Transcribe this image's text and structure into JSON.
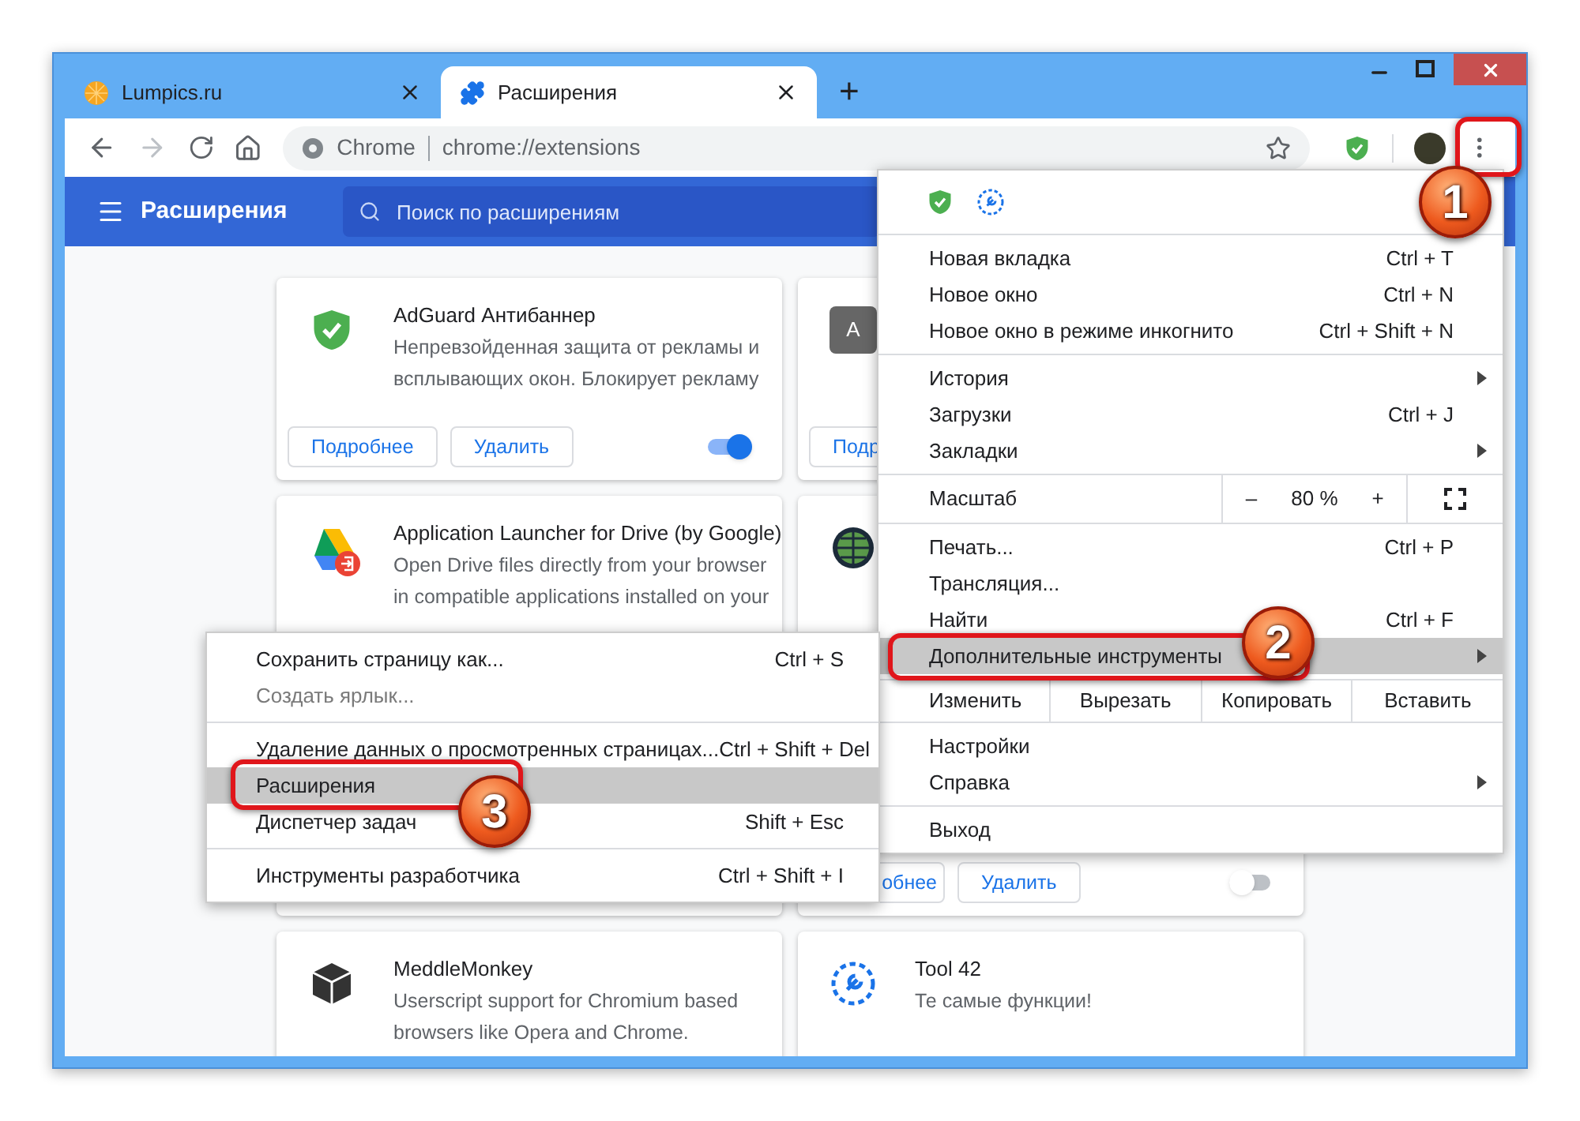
{
  "window": {
    "tabs": [
      {
        "title": "Lumpics.ru",
        "selected": false
      },
      {
        "title": "Расширения",
        "selected": true
      }
    ],
    "new_tab": "+"
  },
  "toolbar": {
    "site_label": "Chrome",
    "url": "chrome://extensions"
  },
  "header": {
    "title": "Расширения",
    "search_placeholder": "Поиск по расширениям"
  },
  "cards": [
    {
      "title": "AdGuard Антибаннер",
      "description": [
        "Непревзойденная защита от рекламы и",
        "всплывающих окон. Блокирует рекламу"
      ],
      "buttons": [
        "Подробнее",
        "Удалить"
      ],
      "toggle": {
        "on": true
      }
    },
    {
      "letter": "A",
      "buttons": [
        "Подр"
      ]
    },
    {
      "title": "Application Launcher for Drive (by Google)",
      "description": [
        "Open Drive files directly from your browser",
        "in compatible applications installed on your"
      ]
    },
    {
      "buttons": [
        "обнее",
        "Удалить"
      ],
      "toggle": {
        "on": false
      }
    },
    {
      "title": "MeddleMonkey",
      "description": [
        "Userscript support for Chromium based",
        "browsers like Opera and Chrome."
      ]
    },
    {
      "title": "Tool 42",
      "description": [
        "Те самые функции!"
      ]
    }
  ],
  "menu": {
    "sections": [
      [
        {
          "kind": "item",
          "label": "Новая вкладка",
          "shortcut": "Ctrl + T",
          "arrow": false,
          "selected": false
        },
        {
          "kind": "item",
          "label": "Новое окно",
          "shortcut": "Ctrl + N",
          "arrow": false,
          "selected": false
        },
        {
          "kind": "item",
          "label": "Новое окно в режиме инкогнито",
          "shortcut": "Ctrl + Shift + N",
          "arrow": false,
          "selected": false
        }
      ],
      [
        {
          "kind": "item",
          "label": "История",
          "arrow": true,
          "selected": false
        },
        {
          "kind": "item",
          "label": "Загрузки",
          "shortcut": "Ctrl + J",
          "arrow": false,
          "selected": false
        },
        {
          "kind": "item",
          "label": "Закладки",
          "arrow": true,
          "selected": false
        }
      ],
      [
        {
          "kind": "zoom",
          "label": "Масштаб",
          "minus": "–",
          "value": "80 %",
          "plus": "+"
        }
      ],
      [
        {
          "kind": "item",
          "label": "Печать...",
          "shortcut": "Ctrl + P",
          "arrow": false,
          "selected": false
        },
        {
          "kind": "item",
          "label": "Трансляция...",
          "arrow": false,
          "selected": false
        },
        {
          "kind": "item",
          "label": "Найти",
          "shortcut": "Ctrl + F",
          "arrow": false,
          "selected": false
        },
        {
          "kind": "item",
          "label": "Дополнительные инструменты",
          "arrow": true,
          "selected": true
        }
      ],
      [
        {
          "kind": "edit",
          "label": "Изменить",
          "actions": [
            "Вырезать",
            "Копировать",
            "Вставить"
          ]
        }
      ],
      [
        {
          "kind": "item",
          "label": "Настройки",
          "arrow": false,
          "selected": false
        },
        {
          "kind": "item",
          "label": "Справка",
          "arrow": true,
          "selected": false
        }
      ],
      [
        {
          "kind": "item",
          "label": "Выход",
          "arrow": false,
          "selected": false
        }
      ]
    ]
  },
  "submenu": {
    "sections": [
      [
        {
          "label": "Сохранить страницу как...",
          "shortcut": "Ctrl + S",
          "disabled": false,
          "selected": false
        },
        {
          "label": "Создать ярлык...",
          "disabled": true,
          "selected": false
        }
      ],
      [
        {
          "label": "Удаление данных о просмотренных страницах...",
          "shortcut": "Ctrl + Shift + Del",
          "disabled": false,
          "selected": false
        },
        {
          "label": "Расширения",
          "disabled": false,
          "selected": true
        },
        {
          "label": "Диспетчер задач",
          "shortcut": "Shift + Esc",
          "disabled": false,
          "selected": false
        }
      ],
      [
        {
          "label": "Инструменты разработчика",
          "shortcut": "Ctrl + Shift + I",
          "disabled": false,
          "selected": false
        }
      ]
    ]
  },
  "annotations": [
    {
      "number": "1"
    },
    {
      "number": "2"
    },
    {
      "number": "3"
    }
  ]
}
